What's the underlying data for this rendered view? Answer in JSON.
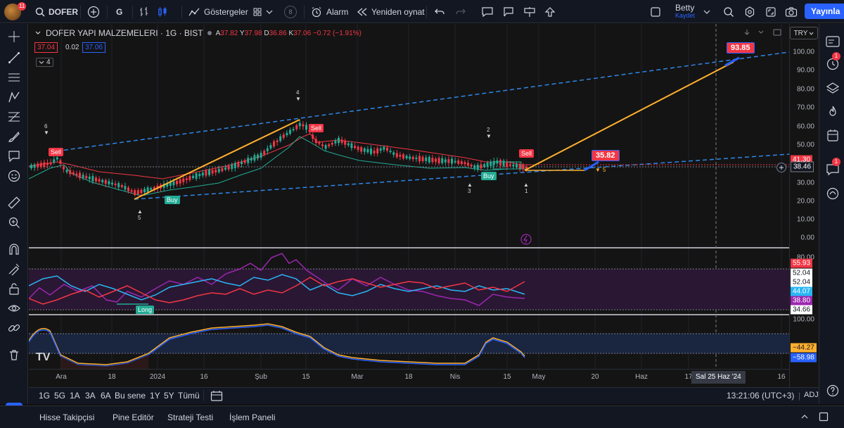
{
  "topbar": {
    "avatar_badge": "11",
    "symbol": "DOFER",
    "interval": "G",
    "indicators_label": "Göstergeler",
    "indicators_badge": "8",
    "alert_label": "Alarm",
    "replay_label": "Yeniden oynat",
    "user_name": "Betty",
    "save_label": "Kaydet",
    "publish_label": "Yayınla"
  },
  "legend": {
    "title": "DOFER YAPI MALZEMELERI · 1G · BIST",
    "open_label": "A",
    "open": "37.82",
    "high_label": "Y",
    "high": "37.98",
    "low_label": "D",
    "low": "36.86",
    "close_label": "K",
    "close": "37.06",
    "change": "−0.72 (−1.91%)",
    "sell_price": "37.04",
    "spread": "0.02",
    "buy_price": "37.06",
    "collapse_count": "4",
    "currency": "TRY"
  },
  "price_axis": {
    "main_labels": [
      "100.00",
      "90.00",
      "80.00",
      "70.00",
      "60.00",
      "50.00",
      "40.00",
      "30.00",
      "20.00",
      "10.00",
      "0.00"
    ],
    "tag_high": "41.30",
    "tag_last": "38.46",
    "osc1_top": "80.00",
    "osc1_tags": [
      "55.93",
      "52.04",
      "52.04",
      "44.07",
      "38.80",
      "34.66"
    ],
    "osc2_top": "100.00",
    "osc2_tags": [
      "−44.27",
      "−58.98"
    ]
  },
  "annotations": {
    "target_price": "93.85",
    "mid_price": "35.82",
    "sell_label": "Sell",
    "buy_label": "Buy",
    "long_label": "Long",
    "wave_labels": [
      "6",
      "4",
      "5",
      "2",
      "3",
      "1"
    ],
    "wave_5_small": "5"
  },
  "date_axis": {
    "labels": [
      "Ara",
      "18",
      "2024",
      "16",
      "Şub",
      "15",
      "Mar",
      "18",
      "Nis",
      "15",
      "May",
      "20",
      "Haz",
      "17",
      "16"
    ],
    "crosshair_date": "Sal 25 Haz '24"
  },
  "range_bar": {
    "ranges": [
      "1G",
      "5G",
      "1A",
      "3A",
      "6A",
      "Bu sene",
      "1Y",
      "5Y",
      "Tümü"
    ],
    "time": "13:21:06 (UTC+3)",
    "adj": "ADJ"
  },
  "bottom_tabs": [
    "Hisse Takipçisi",
    "Pine Editör",
    "Strateji Testi",
    "İşlem Paneli"
  ],
  "right_badges": [
    "1",
    "1"
  ],
  "colors": {
    "red": "#f23645",
    "green": "#22ab94",
    "blue": "#2962ff",
    "orange": "#ffb02e",
    "purple": "#9c27b0",
    "cyan": "#29b6f6"
  }
}
